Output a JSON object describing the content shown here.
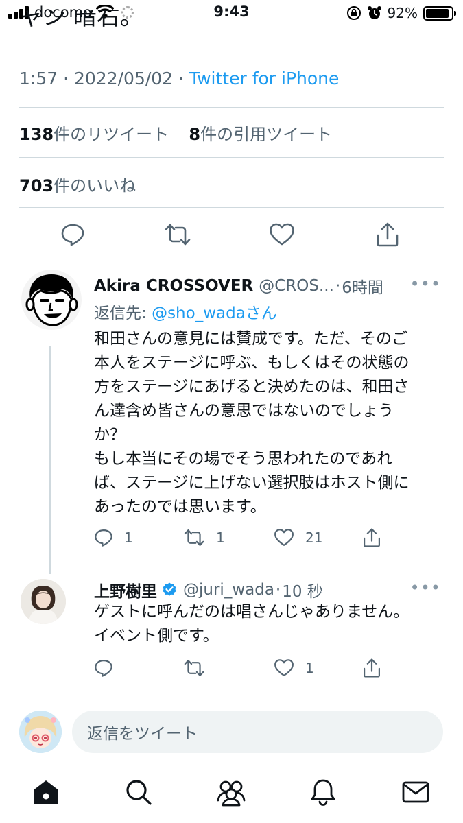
{
  "status_bar": {
    "carrier": "docomo",
    "time": "9:43",
    "battery_percent": "92%",
    "battery_level": 0.92
  },
  "cut_text": "ャン 暗右。",
  "tweet": {
    "time": "1:57",
    "date": "2022/05/02",
    "source": "Twitter for iPhone",
    "retweets_count": "138",
    "retweets_label": "件のリツイート",
    "quotes_count": "8",
    "quotes_label": "件の引用ツイート",
    "likes_count": "703",
    "likes_label": "件のいいね",
    "actions": [
      "reply-icon",
      "retweet-icon",
      "like-icon",
      "share-icon"
    ]
  },
  "reply1": {
    "name": "Akira CROSSOVER",
    "handle": "@CROS...",
    "time_sep": "·",
    "time": "6時間",
    "more": "•••",
    "reply_to_prefix": "返信先: ",
    "reply_to_user": "@sho_wada",
    "reply_to_suffix": "さん",
    "text": "和田さんの意見には賛成です。ただ、そのご\n本人をステージに呼ぶ、もしくはその状態の\n方をステージにあげると決めたのは、和田さ\nん達含め皆さんの意思ではないのでしょう\nか？\nもし本当にその場でそう思われたのであれ\nば、ステージに上げない選択肢はホスト側に\nあったのでは思います。",
    "reply_count": "1",
    "retweet_count": "1",
    "like_count": "21"
  },
  "reply2": {
    "name": "上野樹里",
    "handle": "@juri_wada",
    "time_sep": "·",
    "time": "10 秒",
    "more": "•••",
    "text": "ゲストに呼んだのは唱さんじゃありません。\nイベント側です。",
    "like_count": "1"
  },
  "compose": {
    "placeholder": "返信をツイート"
  },
  "colors": {
    "accent": "#1d9bf0",
    "secondary_text": "#536471",
    "divider": "#cfd9de"
  },
  "tabbar": [
    "home-icon",
    "search-icon",
    "communities-icon",
    "notifications-icon",
    "messages-icon"
  ]
}
